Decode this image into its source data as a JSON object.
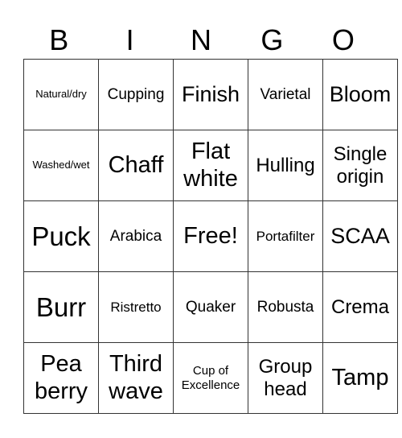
{
  "header": [
    "B",
    "I",
    "N",
    "G",
    "O"
  ],
  "rows": [
    [
      "Natural/dry",
      "Cupping",
      "Finish",
      "Varietal",
      "Bloom"
    ],
    [
      "Washed/wet",
      "Chaff",
      "Flat white",
      "Hulling",
      "Single origin"
    ],
    [
      "Puck",
      "Arabica",
      "Free!",
      "Portafilter",
      "SCAA"
    ],
    [
      "Burr",
      "Ristretto",
      "Quaker",
      "Robusta",
      "Crema"
    ],
    [
      "Pea berry",
      "Third wave",
      "Cup of Excellence",
      "Group head",
      "Tamp"
    ]
  ]
}
